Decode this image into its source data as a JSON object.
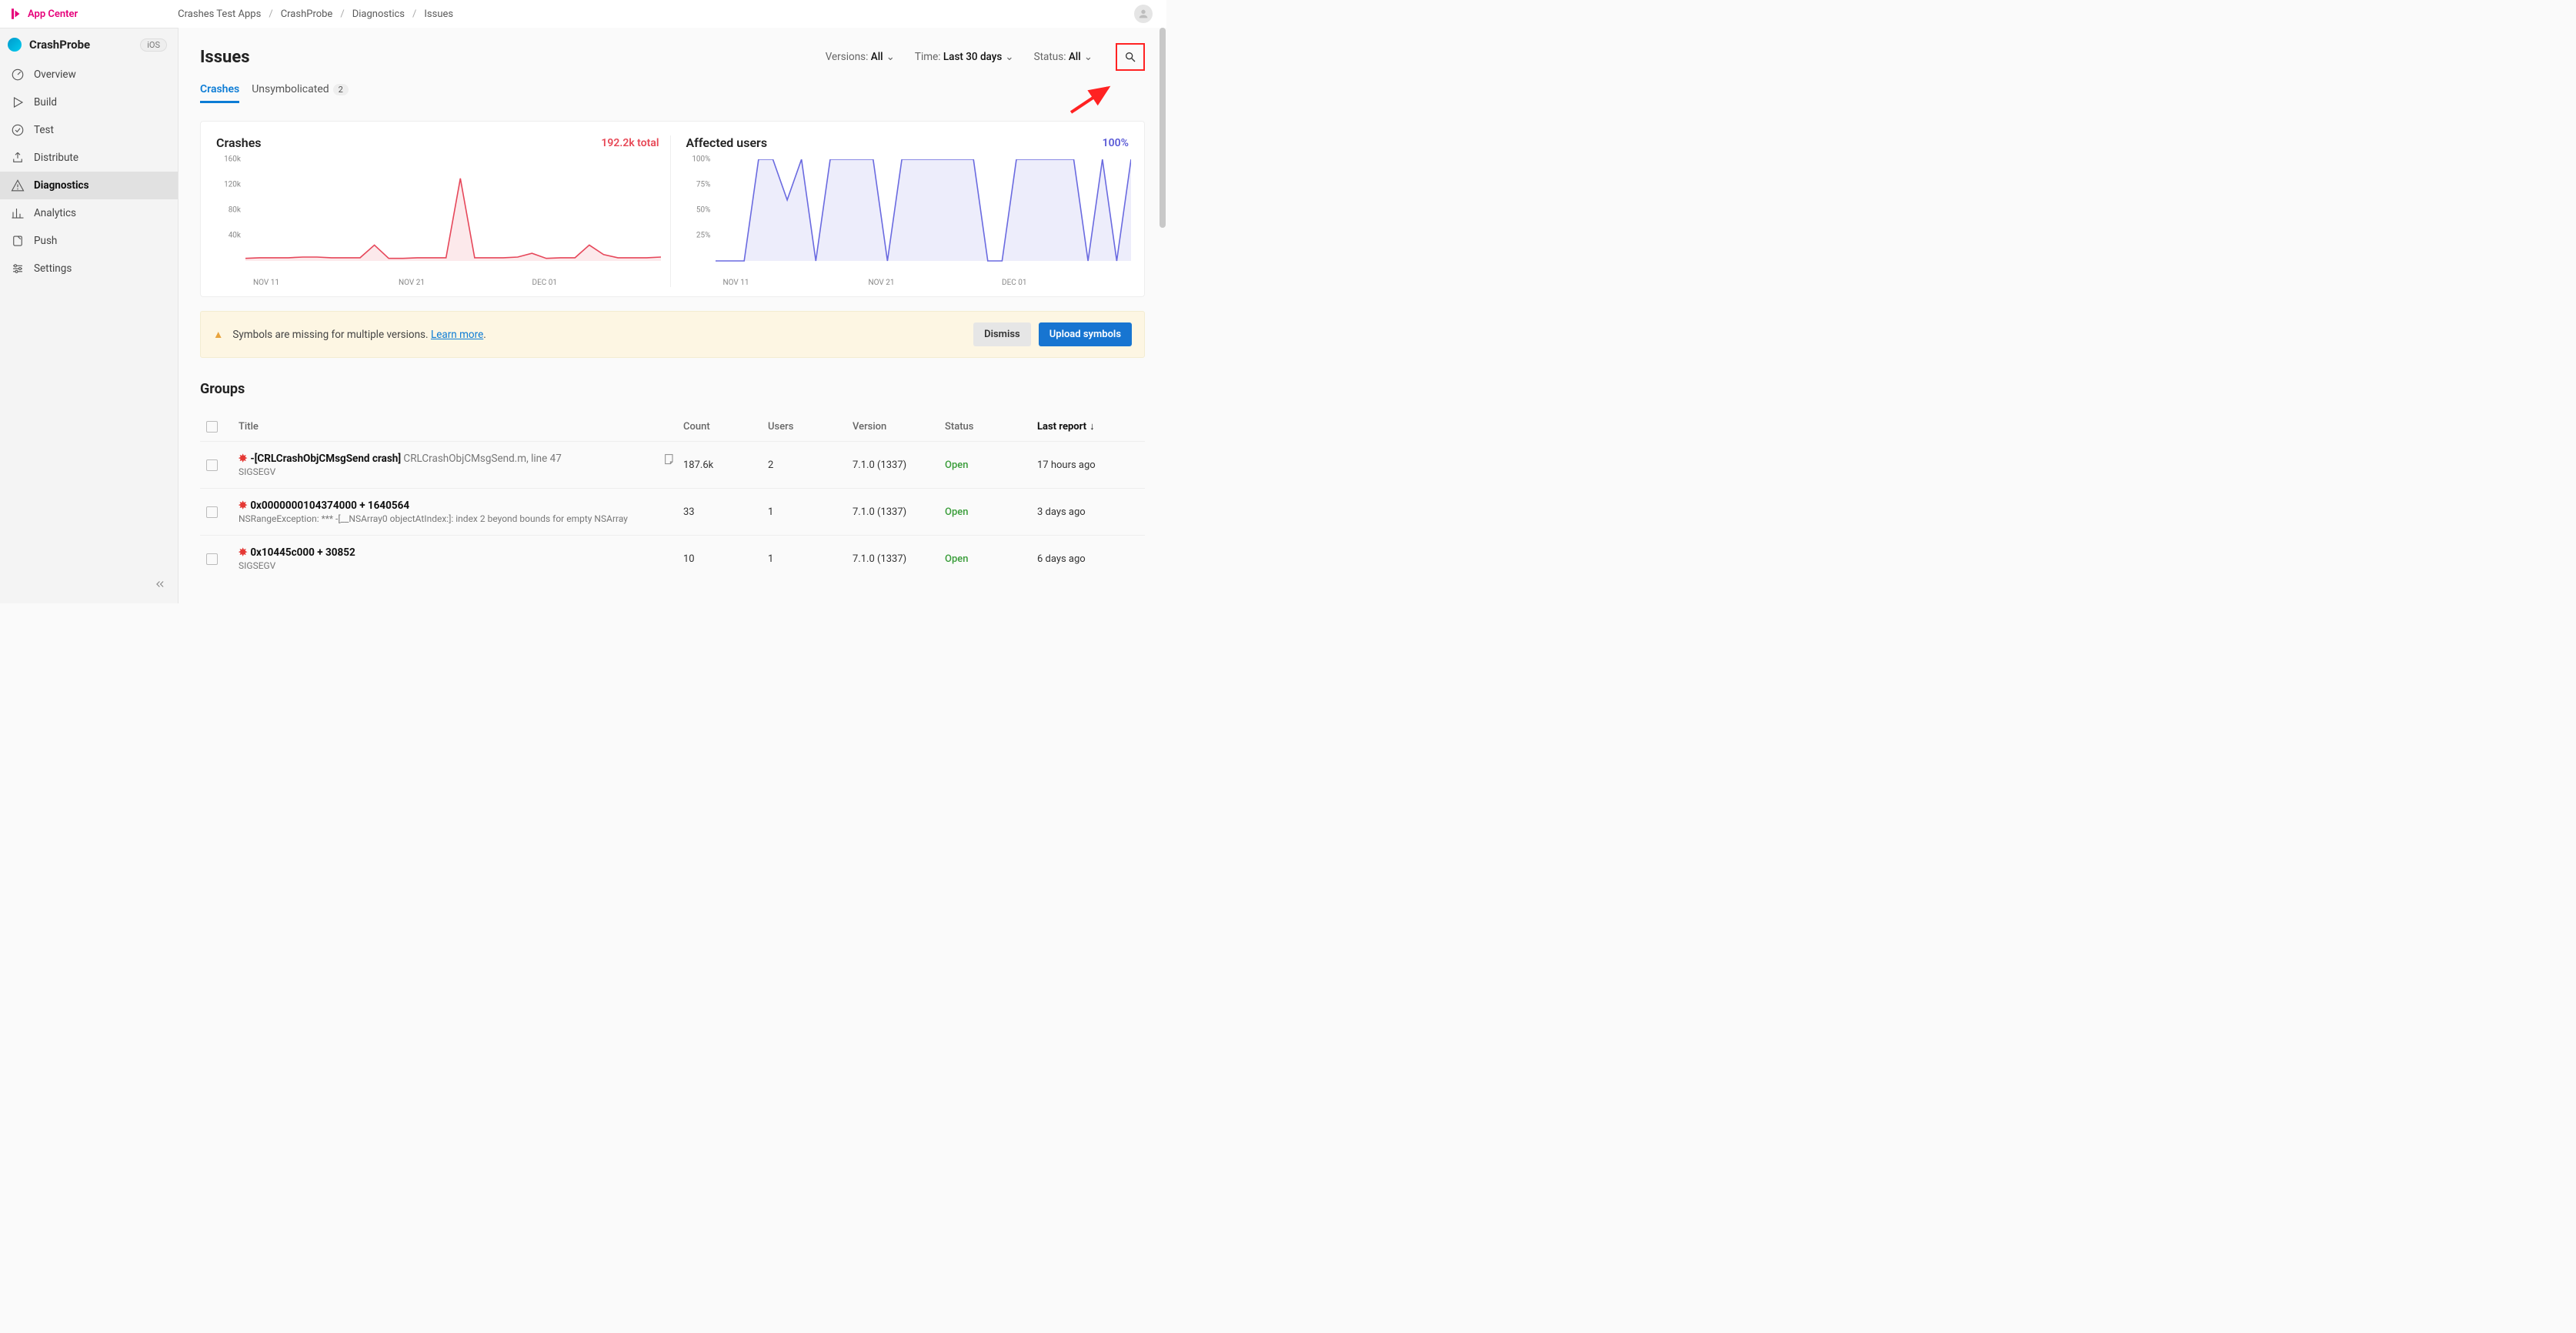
{
  "brand": {
    "name": "App Center"
  },
  "breadcrumb": [
    "Crashes Test Apps",
    "CrashProbe",
    "Diagnostics",
    "Issues"
  ],
  "sidebar": {
    "app_name": "CrashProbe",
    "platform": "iOS",
    "items": [
      {
        "label": "Overview",
        "icon": "gauge-icon"
      },
      {
        "label": "Build",
        "icon": "play-icon"
      },
      {
        "label": "Test",
        "icon": "check-circle-icon"
      },
      {
        "label": "Distribute",
        "icon": "distribute-icon"
      },
      {
        "label": "Diagnostics",
        "icon": "warning-triangle-icon"
      },
      {
        "label": "Analytics",
        "icon": "bar-chart-icon"
      },
      {
        "label": "Push",
        "icon": "push-icon"
      },
      {
        "label": "Settings",
        "icon": "sliders-icon"
      }
    ],
    "active_index": 4
  },
  "page": {
    "title": "Issues",
    "filters": {
      "versions": {
        "label": "Versions:",
        "value": "All"
      },
      "time": {
        "label": "Time:",
        "value": "Last 30 days"
      },
      "status": {
        "label": "Status:",
        "value": "All"
      }
    },
    "tabs": [
      {
        "label": "Crashes",
        "badge": null
      },
      {
        "label": "Unsymbolicated",
        "badge": "2"
      }
    ],
    "active_tab": 0
  },
  "charts": {
    "crashes": {
      "title": "Crashes",
      "stat": "192.2k total"
    },
    "users": {
      "title": "Affected users",
      "stat": "100%"
    }
  },
  "chart_data": [
    {
      "type": "area",
      "title": "Crashes",
      "ylabel": "",
      "ylim": [
        0,
        160000
      ],
      "y_ticks": [
        "40k",
        "80k",
        "120k",
        "160k"
      ],
      "x_ticks": [
        "NOV 11",
        "NOV 21",
        "DEC 01"
      ],
      "x": [
        0,
        1,
        2,
        3,
        4,
        5,
        6,
        7,
        8,
        9,
        10,
        11,
        12,
        13,
        14,
        15,
        16,
        17,
        18,
        19,
        20,
        21,
        22,
        23,
        24,
        25,
        26,
        27,
        28,
        29
      ],
      "values_k": [
        4,
        5,
        5,
        5,
        6,
        6,
        5,
        5,
        5,
        25,
        4,
        4,
        5,
        5,
        5,
        130,
        5,
        5,
        5,
        6,
        12,
        4,
        5,
        5,
        25,
        10,
        5,
        5,
        5,
        6
      ],
      "color": "#e6475a"
    },
    {
      "type": "area",
      "title": "Affected users",
      "ylabel": "%",
      "ylim": [
        0,
        100
      ],
      "y_ticks": [
        "25%",
        "50%",
        "75%",
        "100%"
      ],
      "x_ticks": [
        "NOV 11",
        "NOV 21",
        "DEC 01"
      ],
      "x": [
        0,
        1,
        2,
        3,
        4,
        5,
        6,
        7,
        8,
        9,
        10,
        11,
        12,
        13,
        14,
        15,
        16,
        17,
        18,
        19,
        20,
        21,
        22,
        23,
        24,
        25,
        26,
        27,
        28,
        29
      ],
      "values_pct": [
        0,
        0,
        0,
        100,
        100,
        60,
        100,
        0,
        100,
        100,
        100,
        100,
        0,
        100,
        100,
        100,
        100,
        100,
        100,
        0,
        0,
        100,
        100,
        100,
        100,
        100,
        0,
        100,
        0,
        100
      ],
      "color": "#6a6ae0"
    }
  ],
  "banner": {
    "message": "Symbols are missing for multiple versions. ",
    "link": "Learn more",
    "period": ".",
    "dismiss": "Dismiss",
    "upload": "Upload symbols"
  },
  "groups": {
    "heading": "Groups",
    "columns": [
      "Title",
      "Count",
      "Users",
      "Version",
      "Status",
      "Last report"
    ],
    "rows": [
      {
        "title": "-[CRLCrashObjCMsgSend crash]",
        "subtitle": " CRLCrashObjCMsgSend.m, line 47",
        "detail": "SIGSEGV",
        "count": "187.6k",
        "users": "2",
        "version": "7.1.0 (1337)",
        "status": "Open",
        "last_report": "17 hours ago",
        "show_note_icon": true
      },
      {
        "title": "0x0000000104374000 + 1640564",
        "subtitle": "",
        "detail": "NSRangeException: *** -[__NSArray0 objectAtIndex:]: index 2 beyond bounds for empty NSArray",
        "count": "33",
        "users": "1",
        "version": "7.1.0 (1337)",
        "status": "Open",
        "last_report": "3 days ago",
        "show_note_icon": false
      },
      {
        "title": "0x10445c000 + 30852",
        "subtitle": "",
        "detail": "SIGSEGV",
        "count": "10",
        "users": "1",
        "version": "7.1.0 (1337)",
        "status": "Open",
        "last_report": "6 days ago",
        "show_note_icon": false
      }
    ]
  }
}
